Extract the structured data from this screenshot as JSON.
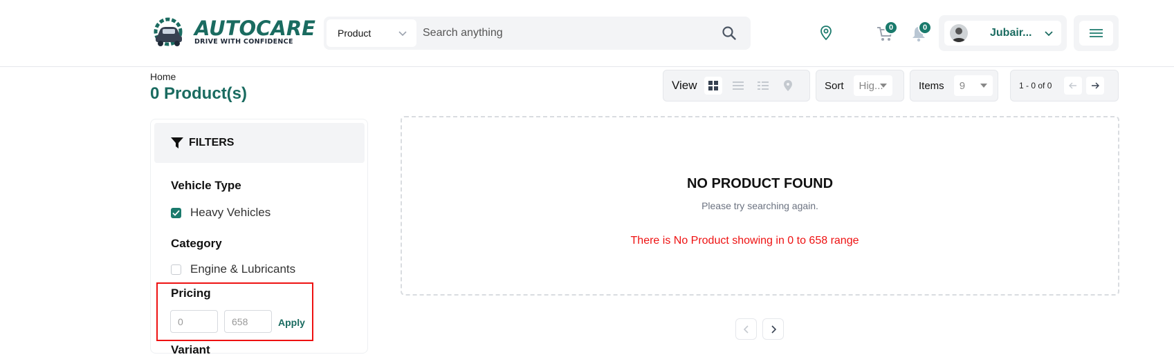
{
  "header": {
    "logo_title": "AUTOCARE",
    "logo_tagline": "DRIVE WITH CONFIDENCE",
    "search": {
      "category": "Product",
      "placeholder": "Search anything"
    },
    "cart_count": "0",
    "notification_count": "0",
    "user_name": "Jubair..."
  },
  "breadcrumb": "Home",
  "page_title": "0 Product(s)",
  "toolbar": {
    "view_label": "View",
    "sort_label": "Sort",
    "sort_value": "Hig...",
    "items_label": "Items",
    "items_value": "9",
    "range_text": "1 - 0 of 0"
  },
  "filters": {
    "title": "FILTERS",
    "vehicle_type": {
      "title": "Vehicle Type",
      "options": [
        {
          "label": "Heavy Vehicles",
          "checked": true
        }
      ]
    },
    "category": {
      "title": "Category",
      "options": [
        {
          "label": "Engine & Lubricants",
          "checked": false
        }
      ]
    },
    "pricing": {
      "title": "Pricing",
      "min_placeholder": "0",
      "max_placeholder": "658",
      "apply_label": "Apply"
    },
    "variant_title": "Variant"
  },
  "empty_state": {
    "title": "NO PRODUCT FOUND",
    "subtitle": "Please try searching again.",
    "note": "There is No Product showing in 0 to 658 range"
  },
  "colors": {
    "brand": "#1a6b60",
    "badge": "#1a7a6c",
    "alert": "#ee1111"
  }
}
